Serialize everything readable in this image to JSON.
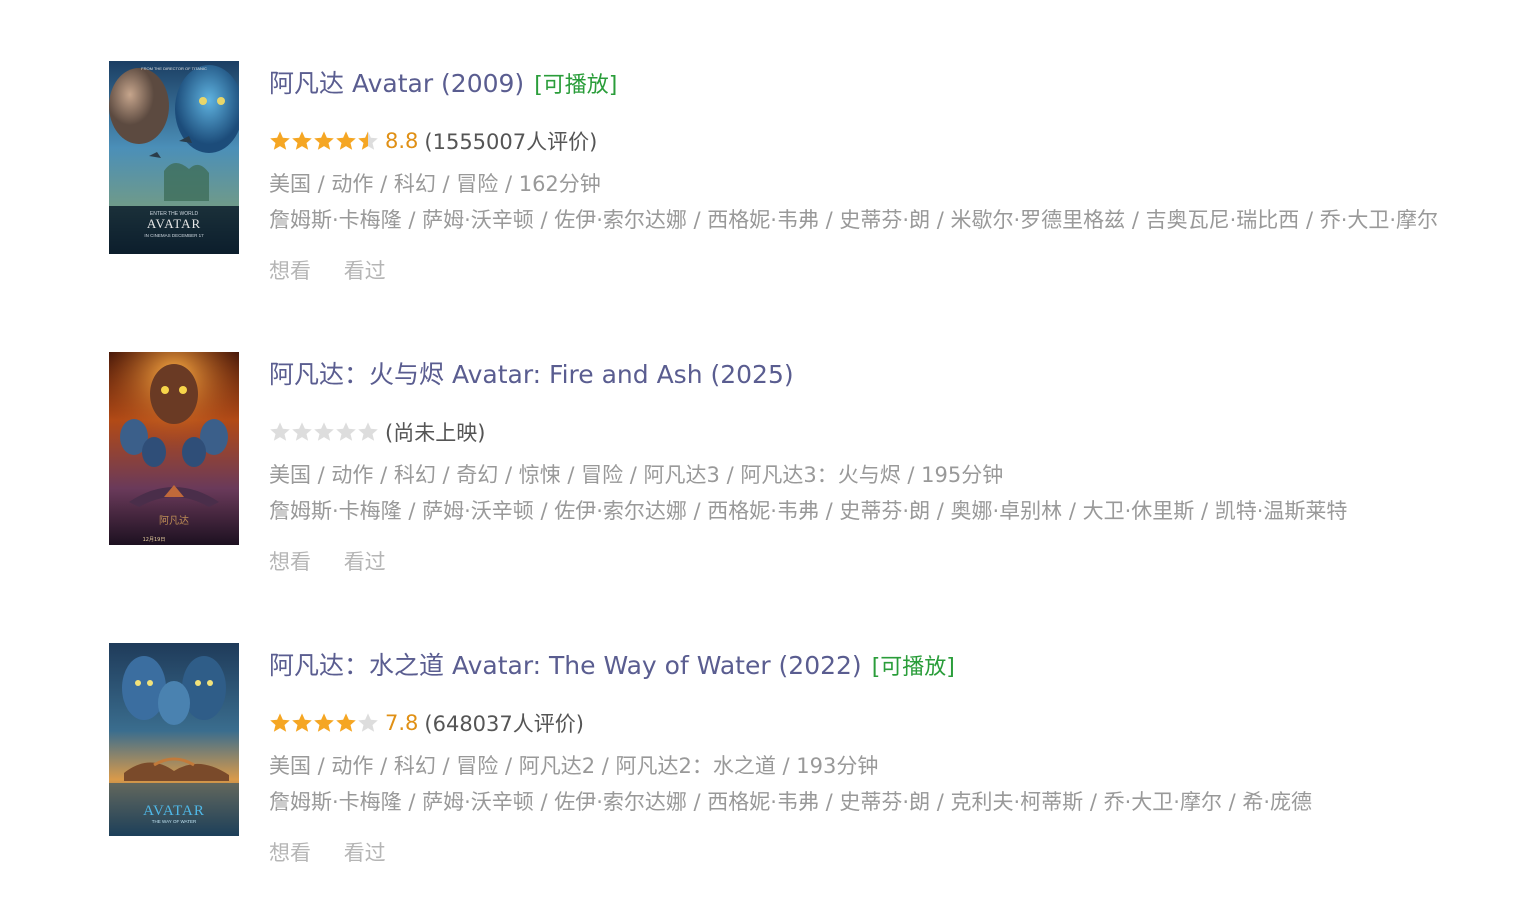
{
  "items": [
    {
      "title": "阿凡达 Avatar (2009)",
      "playable": "[可播放]",
      "rating_score": "8.8",
      "rating_count": "(1555007人评价)",
      "stars": 4.5,
      "meta": "美国 / 动作 / 科幻 / 冒险 / 162分钟",
      "cast": "詹姆斯·卡梅隆 / 萨姆·沃辛顿 / 佐伊·索尔达娜 / 西格妮·韦弗 / 史蒂芬·朗 / 米歇尔·罗德里格兹 / 吉奥瓦尼·瑞比西 / 乔·大卫·摩尔",
      "actions": {
        "want": "想看",
        "seen": "看过"
      },
      "poster": {
        "top_text": "FROM THE DIRECTOR OF TITANIC",
        "sub_text": "ENTER THE WORLD",
        "logo": "AVATAR",
        "date_text": "IN CINEMAS DECEMBER 17"
      }
    },
    {
      "title": "阿凡达：火与烬 Avatar: Fire and Ash (2025)",
      "playable": "",
      "rating_score": "",
      "rating_count": "(尚未上映)",
      "stars": 0,
      "meta": "美国 / 动作 / 科幻 / 奇幻 / 惊悚 / 冒险 / 阿凡达3 / 阿凡达3：火与烬 / 195分钟",
      "cast": "詹姆斯·卡梅隆 / 萨姆·沃辛顿 / 佐伊·索尔达娜 / 西格妮·韦弗 / 史蒂芬·朗 / 奥娜·卓别林 / 大卫·休里斯 / 凯特·温斯莱特",
      "actions": {
        "want": "想看",
        "seen": "看过"
      },
      "poster": {
        "top_text": "",
        "sub_text": "",
        "logo": "",
        "date_text": "12月19日"
      }
    },
    {
      "title": "阿凡达：水之道 Avatar: The Way of Water (2022)",
      "playable": "[可播放]",
      "rating_score": "7.8",
      "rating_count": "(648037人评价)",
      "stars": 4,
      "meta": "美国 / 动作 / 科幻 / 冒险 / 阿凡达2 / 阿凡达2：水之道 / 193分钟",
      "cast": "詹姆斯·卡梅隆 / 萨姆·沃辛顿 / 佐伊·索尔达娜 / 西格妮·韦弗 / 史蒂芬·朗 / 克利夫·柯蒂斯 / 乔·大卫·摩尔 / 希·庞德",
      "actions": {
        "want": "想看",
        "seen": "看过"
      },
      "poster": {
        "top_text": "",
        "sub_text": "",
        "logo": "AVATAR",
        "date_text": "THE WAY OF WATER"
      }
    }
  ],
  "colors": {
    "title": "#5a5d90",
    "playable": "#2a9d3a",
    "star_on": "#f5a623",
    "star_off": "#dddddd",
    "score": "#e09015",
    "meta": "#999999",
    "action": "#b5b5b5"
  },
  "icons": {
    "star_full": "star-full-icon",
    "star_half": "star-half-icon",
    "star_empty": "star-empty-icon"
  }
}
